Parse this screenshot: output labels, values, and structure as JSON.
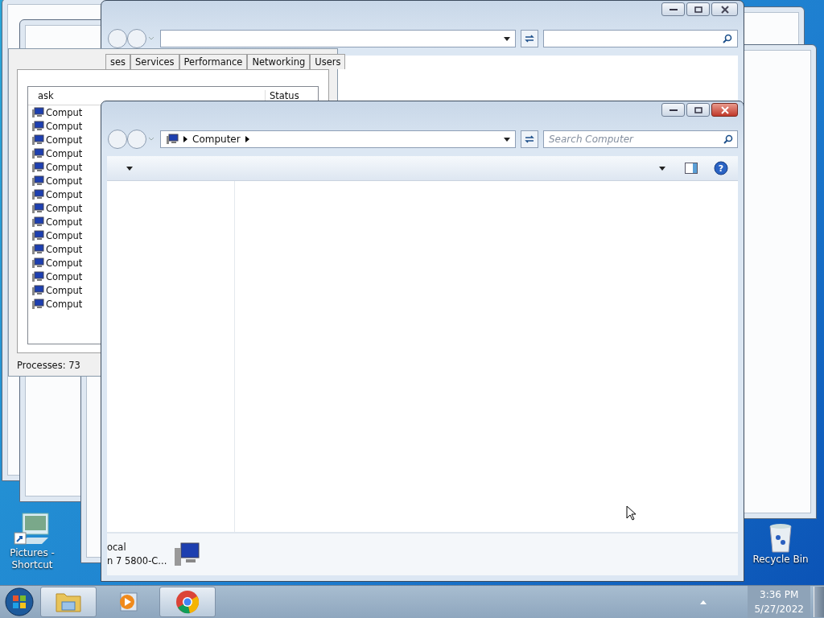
{
  "task_manager": {
    "tabs": [
      {
        "label": "ses",
        "selected": false
      },
      {
        "label": "Services",
        "selected": false
      },
      {
        "label": "Performance",
        "selected": false
      },
      {
        "label": "Networking",
        "selected": false
      },
      {
        "label": "Users",
        "selected": false
      }
    ],
    "columns": [
      "ask",
      "Status"
    ],
    "rows": [
      "Comput",
      "Comput",
      "Comput",
      "Comput",
      "Comput",
      "Comput",
      "Comput",
      "Comput",
      "Comput",
      "Comput",
      "Comput",
      "Comput",
      "Comput",
      "Comput",
      "Comput"
    ],
    "status_bar": "Processes: 73"
  },
  "explorer": {
    "breadcrumb": "Computer",
    "search": {
      "placeholder": "Search Computer"
    },
    "details": [
      "ocal",
      "n 7 5800-C..."
    ],
    "help_glyph": "?"
  },
  "desktop_icons": [
    {
      "kind": "pictures",
      "label": "Pictures - Shortcut"
    },
    {
      "kind": "recycle",
      "label": "Recycle Bin"
    }
  ],
  "taskbar": {
    "apps": [
      {
        "kind": "folder",
        "active": true
      },
      {
        "kind": "media",
        "active": false
      },
      {
        "kind": "browser",
        "active": true
      }
    ],
    "time": "3:36 PM",
    "date": "5/27/2022"
  }
}
